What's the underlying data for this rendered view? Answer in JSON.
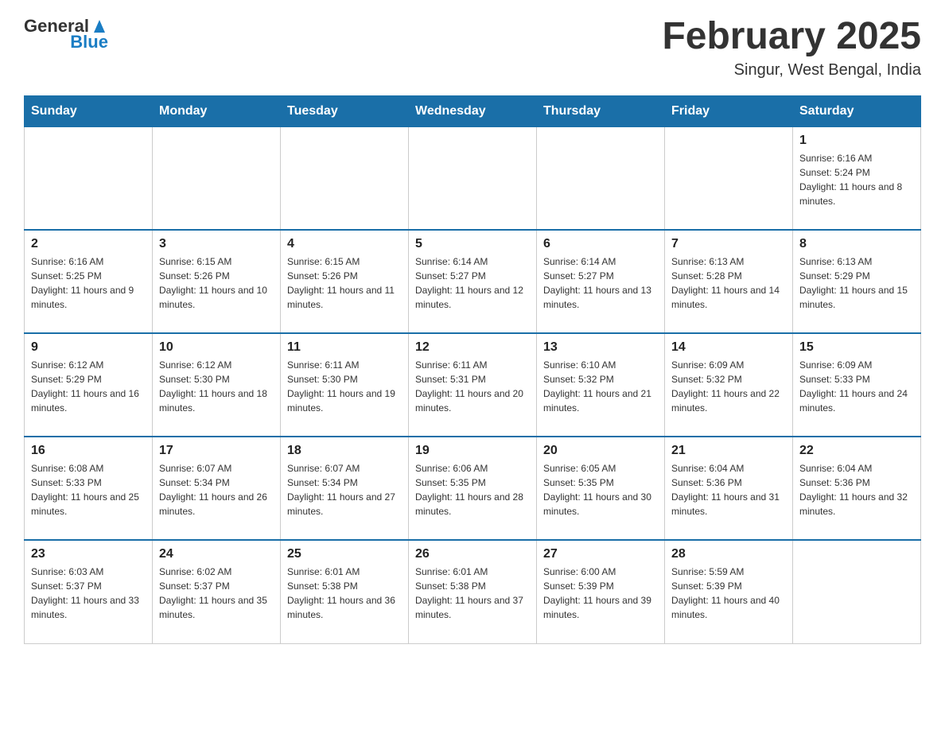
{
  "logo": {
    "general": "General",
    "blue": "Blue"
  },
  "title": "February 2025",
  "subtitle": "Singur, West Bengal, India",
  "weekdays": [
    "Sunday",
    "Monday",
    "Tuesday",
    "Wednesday",
    "Thursday",
    "Friday",
    "Saturday"
  ],
  "weeks": [
    [
      {
        "day": "",
        "info": ""
      },
      {
        "day": "",
        "info": ""
      },
      {
        "day": "",
        "info": ""
      },
      {
        "day": "",
        "info": ""
      },
      {
        "day": "",
        "info": ""
      },
      {
        "day": "",
        "info": ""
      },
      {
        "day": "1",
        "info": "Sunrise: 6:16 AM\nSunset: 5:24 PM\nDaylight: 11 hours and 8 minutes."
      }
    ],
    [
      {
        "day": "2",
        "info": "Sunrise: 6:16 AM\nSunset: 5:25 PM\nDaylight: 11 hours and 9 minutes."
      },
      {
        "day": "3",
        "info": "Sunrise: 6:15 AM\nSunset: 5:26 PM\nDaylight: 11 hours and 10 minutes."
      },
      {
        "day": "4",
        "info": "Sunrise: 6:15 AM\nSunset: 5:26 PM\nDaylight: 11 hours and 11 minutes."
      },
      {
        "day": "5",
        "info": "Sunrise: 6:14 AM\nSunset: 5:27 PM\nDaylight: 11 hours and 12 minutes."
      },
      {
        "day": "6",
        "info": "Sunrise: 6:14 AM\nSunset: 5:27 PM\nDaylight: 11 hours and 13 minutes."
      },
      {
        "day": "7",
        "info": "Sunrise: 6:13 AM\nSunset: 5:28 PM\nDaylight: 11 hours and 14 minutes."
      },
      {
        "day": "8",
        "info": "Sunrise: 6:13 AM\nSunset: 5:29 PM\nDaylight: 11 hours and 15 minutes."
      }
    ],
    [
      {
        "day": "9",
        "info": "Sunrise: 6:12 AM\nSunset: 5:29 PM\nDaylight: 11 hours and 16 minutes."
      },
      {
        "day": "10",
        "info": "Sunrise: 6:12 AM\nSunset: 5:30 PM\nDaylight: 11 hours and 18 minutes."
      },
      {
        "day": "11",
        "info": "Sunrise: 6:11 AM\nSunset: 5:30 PM\nDaylight: 11 hours and 19 minutes."
      },
      {
        "day": "12",
        "info": "Sunrise: 6:11 AM\nSunset: 5:31 PM\nDaylight: 11 hours and 20 minutes."
      },
      {
        "day": "13",
        "info": "Sunrise: 6:10 AM\nSunset: 5:32 PM\nDaylight: 11 hours and 21 minutes."
      },
      {
        "day": "14",
        "info": "Sunrise: 6:09 AM\nSunset: 5:32 PM\nDaylight: 11 hours and 22 minutes."
      },
      {
        "day": "15",
        "info": "Sunrise: 6:09 AM\nSunset: 5:33 PM\nDaylight: 11 hours and 24 minutes."
      }
    ],
    [
      {
        "day": "16",
        "info": "Sunrise: 6:08 AM\nSunset: 5:33 PM\nDaylight: 11 hours and 25 minutes."
      },
      {
        "day": "17",
        "info": "Sunrise: 6:07 AM\nSunset: 5:34 PM\nDaylight: 11 hours and 26 minutes."
      },
      {
        "day": "18",
        "info": "Sunrise: 6:07 AM\nSunset: 5:34 PM\nDaylight: 11 hours and 27 minutes."
      },
      {
        "day": "19",
        "info": "Sunrise: 6:06 AM\nSunset: 5:35 PM\nDaylight: 11 hours and 28 minutes."
      },
      {
        "day": "20",
        "info": "Sunrise: 6:05 AM\nSunset: 5:35 PM\nDaylight: 11 hours and 30 minutes."
      },
      {
        "day": "21",
        "info": "Sunrise: 6:04 AM\nSunset: 5:36 PM\nDaylight: 11 hours and 31 minutes."
      },
      {
        "day": "22",
        "info": "Sunrise: 6:04 AM\nSunset: 5:36 PM\nDaylight: 11 hours and 32 minutes."
      }
    ],
    [
      {
        "day": "23",
        "info": "Sunrise: 6:03 AM\nSunset: 5:37 PM\nDaylight: 11 hours and 33 minutes."
      },
      {
        "day": "24",
        "info": "Sunrise: 6:02 AM\nSunset: 5:37 PM\nDaylight: 11 hours and 35 minutes."
      },
      {
        "day": "25",
        "info": "Sunrise: 6:01 AM\nSunset: 5:38 PM\nDaylight: 11 hours and 36 minutes."
      },
      {
        "day": "26",
        "info": "Sunrise: 6:01 AM\nSunset: 5:38 PM\nDaylight: 11 hours and 37 minutes."
      },
      {
        "day": "27",
        "info": "Sunrise: 6:00 AM\nSunset: 5:39 PM\nDaylight: 11 hours and 39 minutes."
      },
      {
        "day": "28",
        "info": "Sunrise: 5:59 AM\nSunset: 5:39 PM\nDaylight: 11 hours and 40 minutes."
      },
      {
        "day": "",
        "info": ""
      }
    ]
  ]
}
